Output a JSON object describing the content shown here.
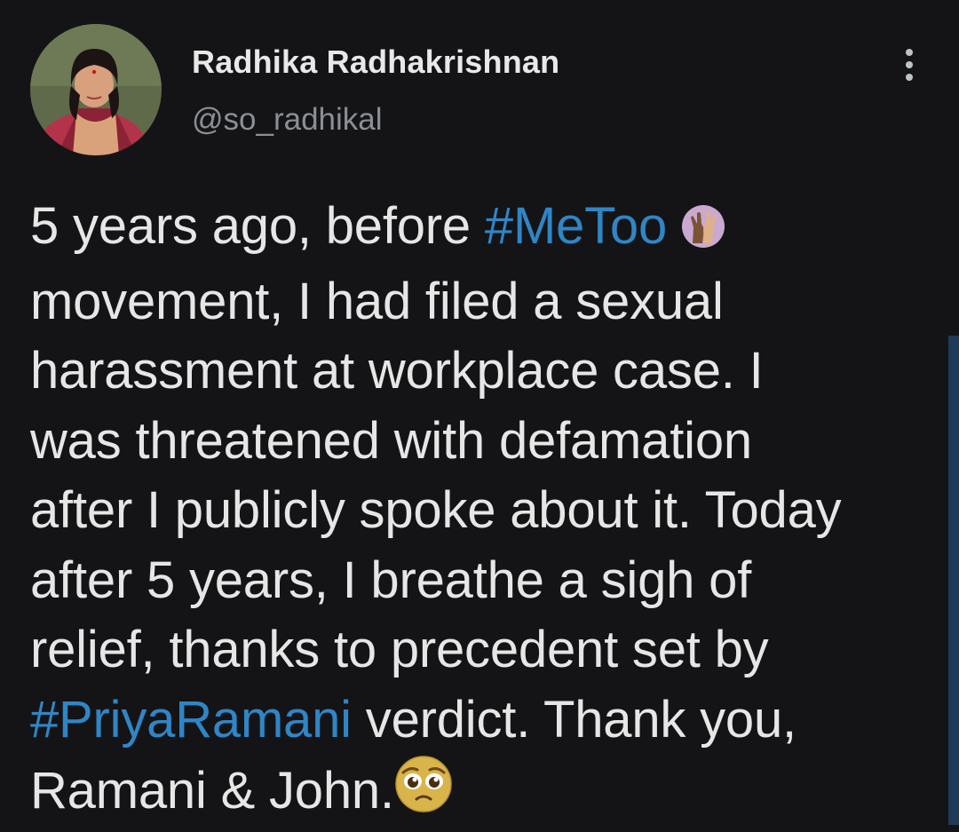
{
  "author": {
    "display_name": "Radhika Radhakrishnan",
    "handle": "@so_radhikal"
  },
  "tweet": {
    "l1_text": "5 years ago, before ",
    "l1_hashtag": "#MeToo",
    "l2": "movement, I had filed a sexual",
    "l3": "harassment at workplace case. I",
    "l4": "was threatened with defamation",
    "l5": "after I publicly spoke about it. Today",
    "l6": "after 5 years, I breathe a sigh of",
    "l7": "relief, thanks to precedent set by",
    "l8_hashtag": "#PriyaRamani",
    "l8_text": " verdict. Thank you,",
    "l9": "Ramani & John."
  },
  "icons": {
    "raised_hands": "raised-hands-emoji",
    "pleading_face": "pleading-face-emoji",
    "more": "more-vertical-icon"
  },
  "colors": {
    "background": "#141416",
    "hashtag": "#2f86c6",
    "handle": "#8b8f94"
  }
}
